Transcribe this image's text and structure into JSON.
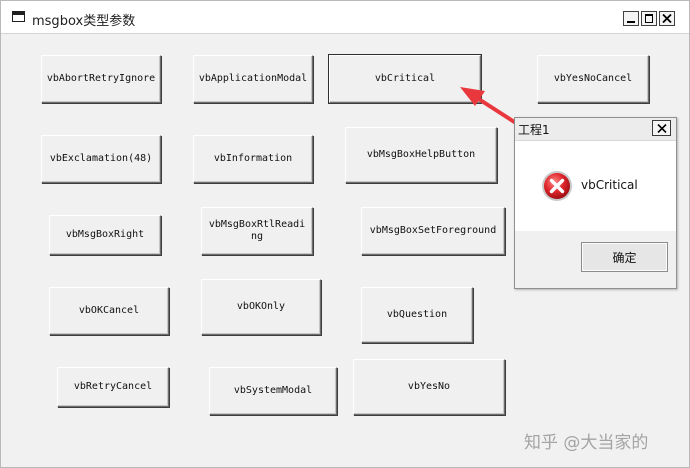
{
  "window": {
    "title": "msgbox类型参数",
    "icon": "app-window-icon",
    "controls": [
      "minimize",
      "maximize",
      "close"
    ]
  },
  "buttons": {
    "vbAbortRetryIgnore": "vbAbortRetryIgnore",
    "vbApplicationModal": "vbApplicationModal",
    "vbCritical": "vbCritical",
    "vbYesNoCancel": "vbYesNoCancel",
    "vbExclamation": "vbExclamation(48)",
    "vbInformation": "vbInformation",
    "vbMsgBoxHelpButton": "vbMsgBoxHelpButton",
    "vbMsgBoxRight": "vbMsgBoxRight",
    "vbMsgBoxRtlReading": "vbMsgBoxRtlReading",
    "vbMsgBoxSetForeground": "vbMsgBoxSetForeground",
    "vbOKCancel": "vbOKCancel",
    "vbOKOnly": "vbOKOnly",
    "vbQuestion": "vbQuestion",
    "vbRetryCancel": "vbRetryCancel",
    "vbSystemModal": "vbSystemModal",
    "vbYesNo": "vbYesNo"
  },
  "dialog": {
    "title": "工程1",
    "message": "vbCritical",
    "icon": "error-icon",
    "ok_label": "确定"
  },
  "annotation": {
    "arrow_color": "#e8383d"
  },
  "watermark": "知乎 @大当家的",
  "colors": {
    "error_red": "#d9262b",
    "arrow_red": "#e8383d"
  }
}
